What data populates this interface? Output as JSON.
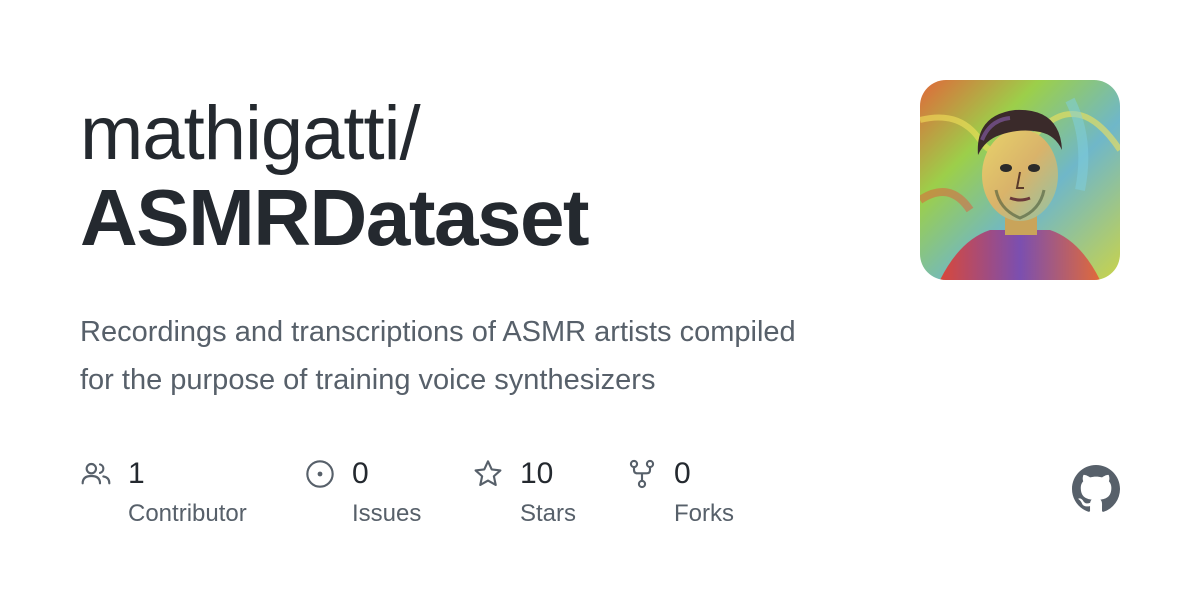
{
  "repo": {
    "owner": "mathigatti/",
    "name": "ASMRDataset",
    "description": "Recordings and transcriptions of ASMR artists compiled for the purpose of training voice synthesizers"
  },
  "stats": [
    {
      "icon": "people-icon",
      "count": "1",
      "label": "Contributor"
    },
    {
      "icon": "issue-icon",
      "count": "0",
      "label": "Issues"
    },
    {
      "icon": "star-icon",
      "count": "10",
      "label": "Stars"
    },
    {
      "icon": "fork-icon",
      "count": "0",
      "label": "Forks"
    }
  ],
  "logo": {
    "icon": "github-icon"
  },
  "colors": {
    "text_primary": "#24292f",
    "text_secondary": "#57606a",
    "background": "#ffffff",
    "icon": "#57606a"
  }
}
